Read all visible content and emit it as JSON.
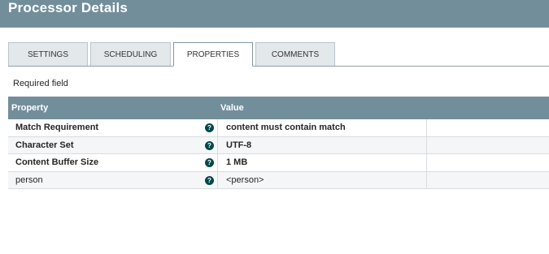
{
  "header": {
    "title": "Processor Details"
  },
  "tabs": [
    {
      "label": "SETTINGS",
      "active": false
    },
    {
      "label": "SCHEDULING",
      "active": false
    },
    {
      "label": "PROPERTIES",
      "active": true
    },
    {
      "label": "COMMENTS",
      "active": false
    }
  ],
  "required_label": "Required field",
  "grid": {
    "columns": {
      "property": "Property",
      "value": "Value"
    },
    "rows": [
      {
        "name": "Match Requirement",
        "value": "content must contain match",
        "required": true,
        "help_icon": "question-circle-icon"
      },
      {
        "name": "Character Set",
        "value": "UTF-8",
        "required": true,
        "help_icon": "question-circle-icon"
      },
      {
        "name": "Content Buffer Size",
        "value": "1 MB",
        "required": true,
        "help_icon": "question-circle-icon"
      },
      {
        "name": "person",
        "value": "<person>",
        "required": false,
        "help_icon": "question-circle-icon"
      }
    ]
  },
  "colors": {
    "header_bg": "#728e9b",
    "help_icon": "#004849"
  }
}
